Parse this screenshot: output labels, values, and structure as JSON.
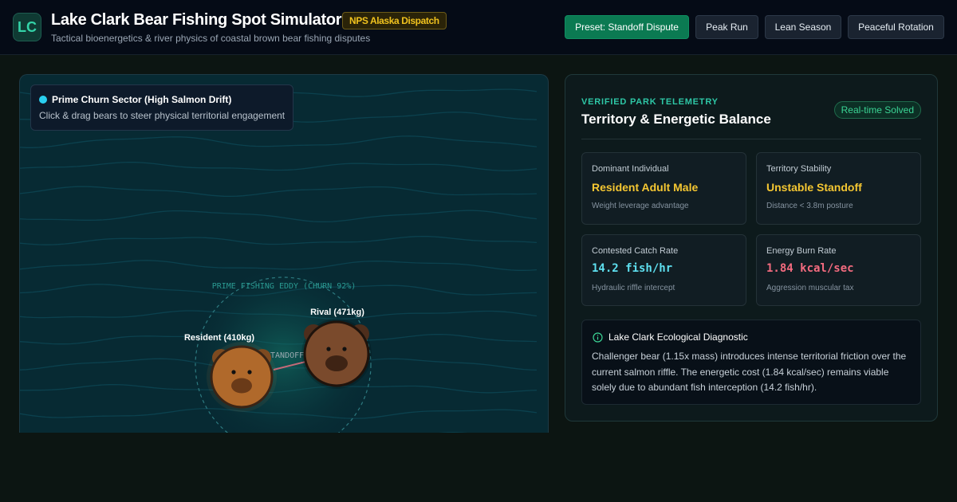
{
  "header": {
    "logo_text": "LC",
    "title": "Lake Clark Bear Fishing Spot Simulator",
    "badge": "NPS Alaska Dispatch",
    "subtitle": "Tactical bioenergetics & river physics of coastal brown bear fishing disputes",
    "presets": [
      {
        "label": "Preset: Standoff Dispute",
        "active": true
      },
      {
        "label": "Peak Run",
        "active": false
      },
      {
        "label": "Lean Season",
        "active": false
      },
      {
        "label": "Peaceful Rotation",
        "active": false
      }
    ]
  },
  "simulation": {
    "sector_title": "Prime Churn Sector (High Salmon Drift)",
    "sector_hint": "Click & drag bears to steer physical territorial engagement",
    "eddy_label": "PRIME FISHING EDDY (CHURN 92%)",
    "engagement_label": "STANDOFF 4",
    "bears": [
      {
        "label": "Resident (410kg)",
        "role": "resident"
      },
      {
        "label": "Rival (471kg)",
        "role": "rival"
      }
    ],
    "colors": {
      "water": "#072a33",
      "current_lines": "#0e4a58",
      "eddy_ring": "#2d7a80",
      "resident_fur": "#b0692b",
      "rival_fur": "#7a4a2c",
      "tension_line": "#c46a78"
    }
  },
  "telemetry": {
    "kicker": "VERIFIED PARK TELEMETRY",
    "title": "Territory & Energetic Balance",
    "status_badge": "Real-time Solved",
    "stats": [
      {
        "label": "Dominant Individual",
        "value": "Resident Adult Male",
        "note": "Weight leverage advantage",
        "color": "#f5c732"
      },
      {
        "label": "Territory Stability",
        "value": "Unstable Standoff",
        "note": "Distance < 3.8m posture",
        "color": "#f5c732"
      },
      {
        "label": "Contested Catch Rate",
        "value": "14.2 fish/hr",
        "note": "Hydraulic riffle intercept",
        "color": "#5ee0f0"
      },
      {
        "label": "Energy Burn Rate",
        "value": "1.84 kcal/sec",
        "note": "Aggression muscular tax",
        "color": "#f36b7f"
      }
    ],
    "diagnostic": {
      "icon": "info-circle-icon",
      "title": "Lake Clark Ecological Diagnostic",
      "body": "Challenger bear (1.15x mass) introduces intense territorial friction over the current salmon riffle. The energetic cost (1.84 kcal/sec) remains viable solely due to abundant fish interception (14.2 fish/hr)."
    }
  }
}
